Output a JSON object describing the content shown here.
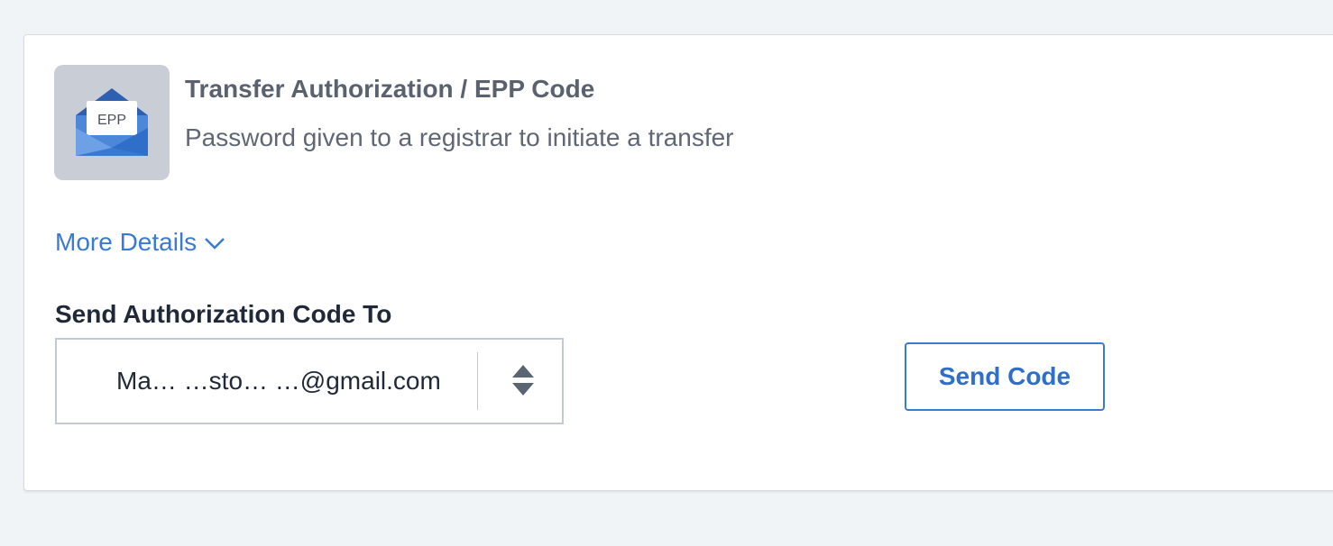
{
  "header": {
    "icon_badge_text": "EPP",
    "title": "Transfer Authorization / EPP Code",
    "subtitle": "Password given to a registrar to initiate a transfer"
  },
  "more_details": {
    "label": "More Details"
  },
  "send_to": {
    "label": "Send Authorization Code To",
    "selected_value": "Ma… …sto… …@gmail.com"
  },
  "actions": {
    "send_code_label": "Send Code"
  },
  "colors": {
    "page_background": "#f1f4f7",
    "accent": "#3b7ad1",
    "icon_tile": "#c8cdd6",
    "envelope_blue": "#3a79d2"
  },
  "icons": {
    "header_icon": "envelope-epp-icon",
    "more_details_icon": "chevron-down-icon",
    "select_icon": "sort-arrows-icon"
  }
}
